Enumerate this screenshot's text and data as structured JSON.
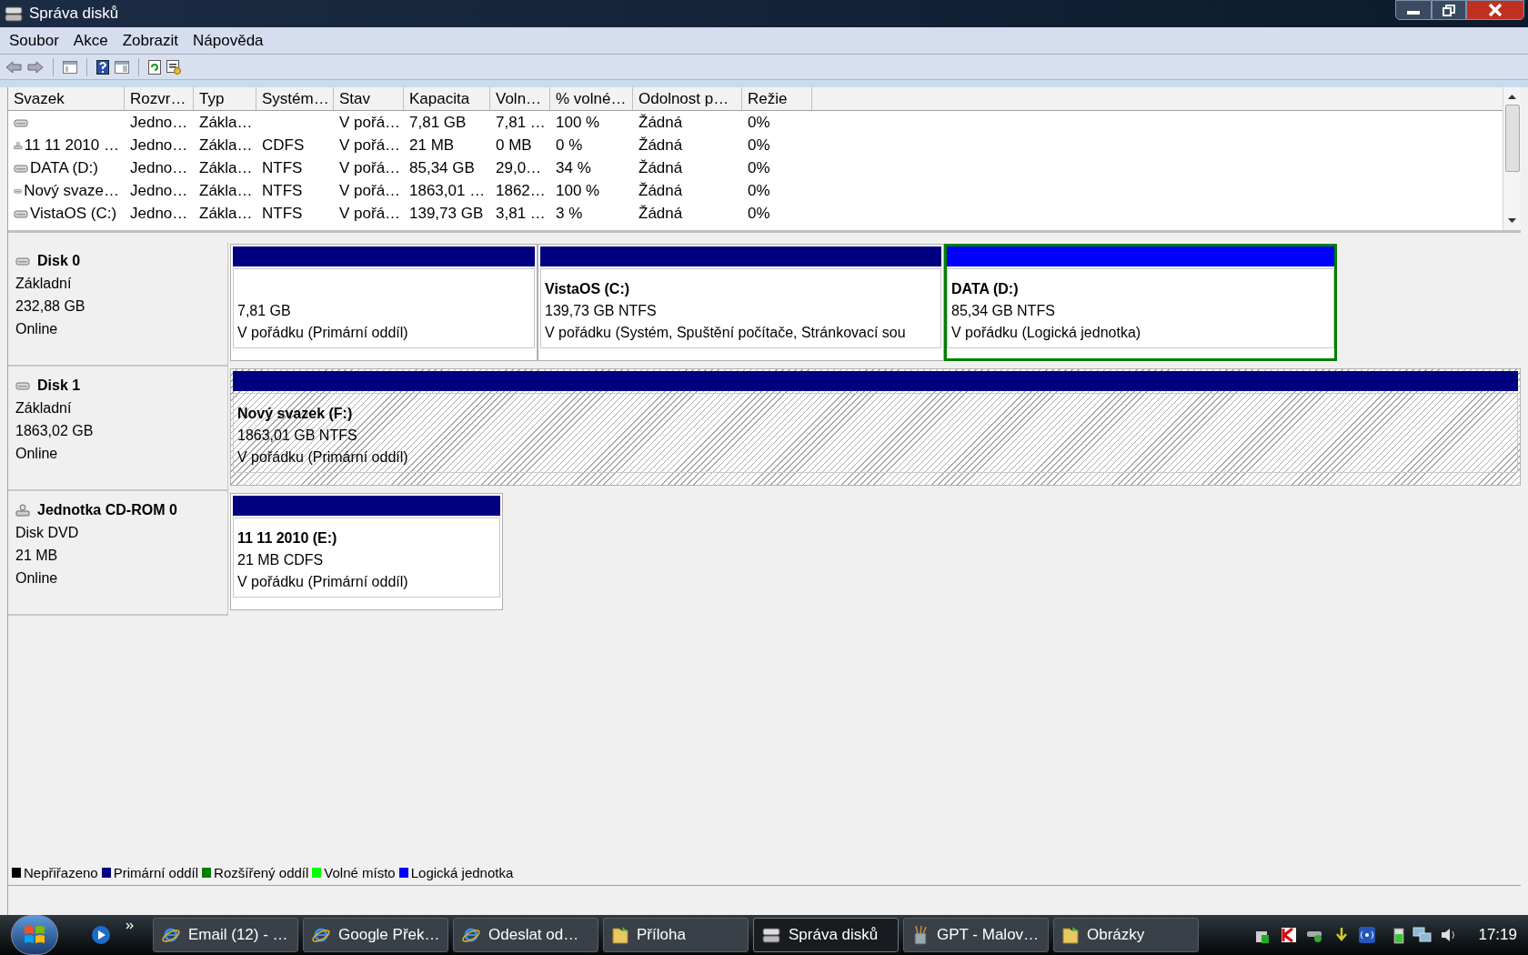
{
  "window": {
    "title": "Správa disků"
  },
  "menu": [
    "Soubor",
    "Akce",
    "Zobrazit",
    "Nápověda"
  ],
  "toolbar": [
    {
      "kind": "back"
    },
    {
      "kind": "forward"
    },
    {
      "kind": "sep"
    },
    {
      "kind": "tree"
    },
    {
      "kind": "sep"
    },
    {
      "kind": "help"
    },
    {
      "kind": "panel"
    },
    {
      "kind": "sep"
    },
    {
      "kind": "refresh"
    },
    {
      "kind": "properties"
    }
  ],
  "table": {
    "columns": [
      "Svazek",
      "Rozvr…",
      "Typ",
      "Systém…",
      "Stav",
      "Kapacita",
      "Voln…",
      "% volné…",
      "Odolnost p…",
      "Režie"
    ],
    "rows": [
      {
        "kind": "disk",
        "cells": [
          "",
          "Jedno…",
          "Zákla…",
          "",
          "V pořá…",
          "7,81 GB",
          "7,81 …",
          "100 %",
          "Žádná",
          "0%"
        ]
      },
      {
        "kind": "cd",
        "cells": [
          "11 11 2010 …",
          "Jedno…",
          "Zákla…",
          "CDFS",
          "V pořá…",
          "21 MB",
          "0 MB",
          "0 %",
          "Žádná",
          "0%"
        ]
      },
      {
        "kind": "disk",
        "cells": [
          "DATA (D:)",
          "Jedno…",
          "Zákla…",
          "NTFS",
          "V pořá…",
          "85,34 GB",
          "29,0…",
          "34 %",
          "Žádná",
          "0%"
        ]
      },
      {
        "kind": "disk",
        "cells": [
          "Nový svaze…",
          "Jedno…",
          "Zákla…",
          "NTFS",
          "V pořá…",
          "1863,01 …",
          "1862…",
          "100 %",
          "Žádná",
          "0%"
        ]
      },
      {
        "kind": "disk",
        "cells": [
          "VistaOS (C:)",
          "Jedno…",
          "Zákla…",
          "NTFS",
          "V pořá…",
          "139,73 GB",
          "3,81 …",
          "3 %",
          "Žádná",
          "0%"
        ]
      }
    ]
  },
  "disks": [
    {
      "kind": "disk",
      "name": "Disk 0",
      "lines": [
        "Základní",
        "232,88 GB",
        "Online"
      ],
      "partitions": [
        {
          "kind": "primary",
          "lines": [
            "7,81 GB",
            "V pořádku (Primární oddíl)"
          ],
          "selected": false,
          "focused": false
        },
        {
          "kind": "primary",
          "name": "VistaOS  (C:)",
          "lines": [
            "139,73 GB NTFS",
            "V pořádku (Systém, Spuštění počítače, Stránkovací sou"
          ],
          "selected": false,
          "focused": false
        },
        {
          "kind": "logical",
          "name": "DATA  (D:)",
          "lines": [
            "85,34 GB NTFS",
            "V pořádku (Logická jednotka)"
          ],
          "selected": false,
          "focused": true
        }
      ]
    },
    {
      "kind": "disk",
      "name": "Disk 1",
      "lines": [
        "Základní",
        "1863,02 GB",
        "Online"
      ],
      "partitions": [
        {
          "kind": "primary",
          "name": "Nový svazek  (F:)",
          "lines": [
            "1863,01 GB NTFS",
            "V pořádku (Primární oddíl)"
          ],
          "selected": true,
          "focused": false
        }
      ]
    },
    {
      "kind": "cd",
      "name": "Jednotka CD-ROM 0",
      "lines": [
        "Disk DVD",
        "21 MB",
        "Online"
      ],
      "partitions": [
        {
          "kind": "primary",
          "name": "11 11 2010  (E:)",
          "lines": [
            "21 MB CDFS",
            "V pořádku (Primární oddíl)"
          ],
          "selected": false,
          "focused": false
        }
      ]
    }
  ],
  "legend": [
    {
      "label": "Nepřiřazeno",
      "color": "#000000"
    },
    {
      "label": "Primární oddíl",
      "color": "#000080"
    },
    {
      "label": "Rozšířený oddíl",
      "color": "#008000"
    },
    {
      "label": "Volné místo",
      "color": "#00ff00"
    },
    {
      "label": "Logická jednotka",
      "color": "#0000ff"
    }
  ],
  "taskbar": {
    "items": [
      {
        "kind": "ie",
        "label": "Email (12) - …",
        "selected": false
      },
      {
        "kind": "ie",
        "label": "Google Přek…",
        "selected": false
      },
      {
        "kind": "ie",
        "label": "Odeslat od…",
        "selected": false
      },
      {
        "kind": "folder",
        "label": "Příloha",
        "selected": false
      },
      {
        "kind": "disk",
        "label": "Správa disků",
        "selected": true
      },
      {
        "kind": "paint",
        "label": "GPT - Malov…",
        "selected": false
      },
      {
        "kind": "folder",
        "label": "Obrázky",
        "selected": false
      }
    ],
    "clock": "17:19"
  }
}
